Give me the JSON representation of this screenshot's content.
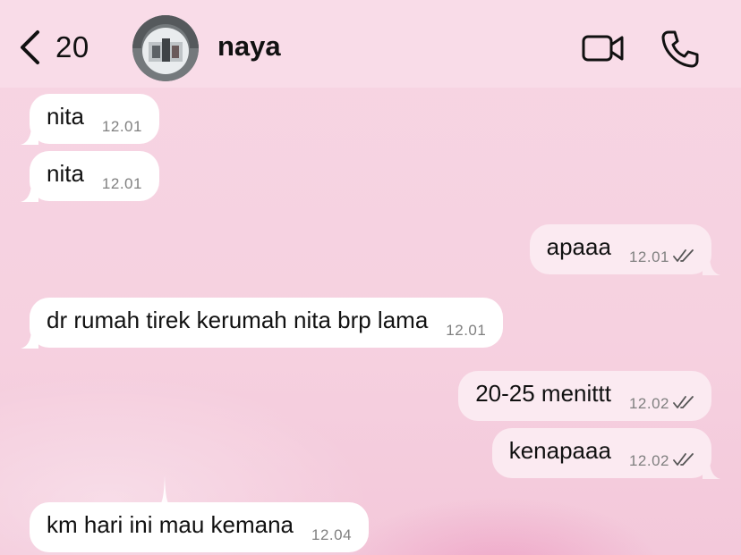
{
  "header": {
    "unread_count": "20",
    "contact_name": "naya"
  },
  "icons": {
    "back": "chevron-left-icon",
    "video": "video-camera-icon",
    "call": "phone-icon",
    "read_receipt": "double-check-icon"
  },
  "colors": {
    "background": "#f6d3e1",
    "incoming_bubble": "#ffffff",
    "outgoing_bubble": "#fbeaf1",
    "timestamp": "#808080"
  },
  "messages": [
    {
      "direction": "in",
      "text": "nita",
      "time": "12.01"
    },
    {
      "direction": "in",
      "text": "nita",
      "time": "12.01"
    },
    {
      "direction": "out",
      "text": "apaaa",
      "time": "12.01",
      "read": true
    },
    {
      "direction": "in",
      "text": "dr rumah tirek kerumah nita brp lama",
      "time": "12.01"
    },
    {
      "direction": "out",
      "text": "20-25 menittt",
      "time": "12.02",
      "read": true
    },
    {
      "direction": "out",
      "text": "kenapaaa",
      "time": "12.02",
      "read": true
    },
    {
      "direction": "in",
      "text": "km hari ini mau kemana",
      "time": "12.04"
    }
  ]
}
